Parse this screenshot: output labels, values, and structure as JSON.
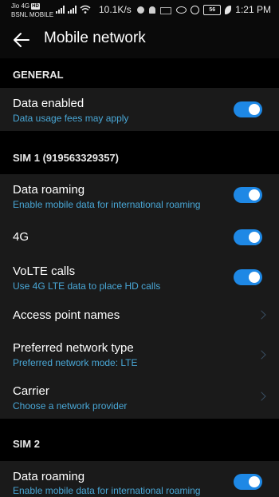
{
  "status_bar": {
    "carrier1": "Jio 4G",
    "carrier1_badge": "HD",
    "carrier2": "BSNL MOBILE",
    "speed": "10.1K/s",
    "battery": "56",
    "time": "1:21 PM"
  },
  "toolbar": {
    "title": "Mobile network"
  },
  "sections": {
    "general": "GENERAL",
    "sim1": "SIM 1 (919563329357)",
    "sim2": "SIM 2"
  },
  "items": {
    "data_enabled": {
      "title": "Data enabled",
      "subtitle": "Data usage fees may apply",
      "on": true
    },
    "sim1_roaming": {
      "title": "Data roaming",
      "subtitle": "Enable mobile data for international roaming",
      "on": true
    },
    "sim1_4g": {
      "title": "4G",
      "on": true
    },
    "sim1_volte": {
      "title": "VoLTE calls",
      "subtitle": "Use 4G LTE data to place HD calls",
      "on": true
    },
    "sim1_apn": {
      "title": "Access point names"
    },
    "sim1_network_type": {
      "title": "Preferred network type",
      "subtitle": "Preferred network mode: LTE"
    },
    "sim1_carrier": {
      "title": "Carrier",
      "subtitle": "Choose a network provider"
    },
    "sim2_roaming": {
      "title": "Data roaming",
      "subtitle": "Enable mobile data for international roaming",
      "on": true
    }
  },
  "colors": {
    "accent": "#1e88e5",
    "subtitle": "#49a7d6",
    "background": "#0a0a0a",
    "card": "#1a1a1a"
  }
}
